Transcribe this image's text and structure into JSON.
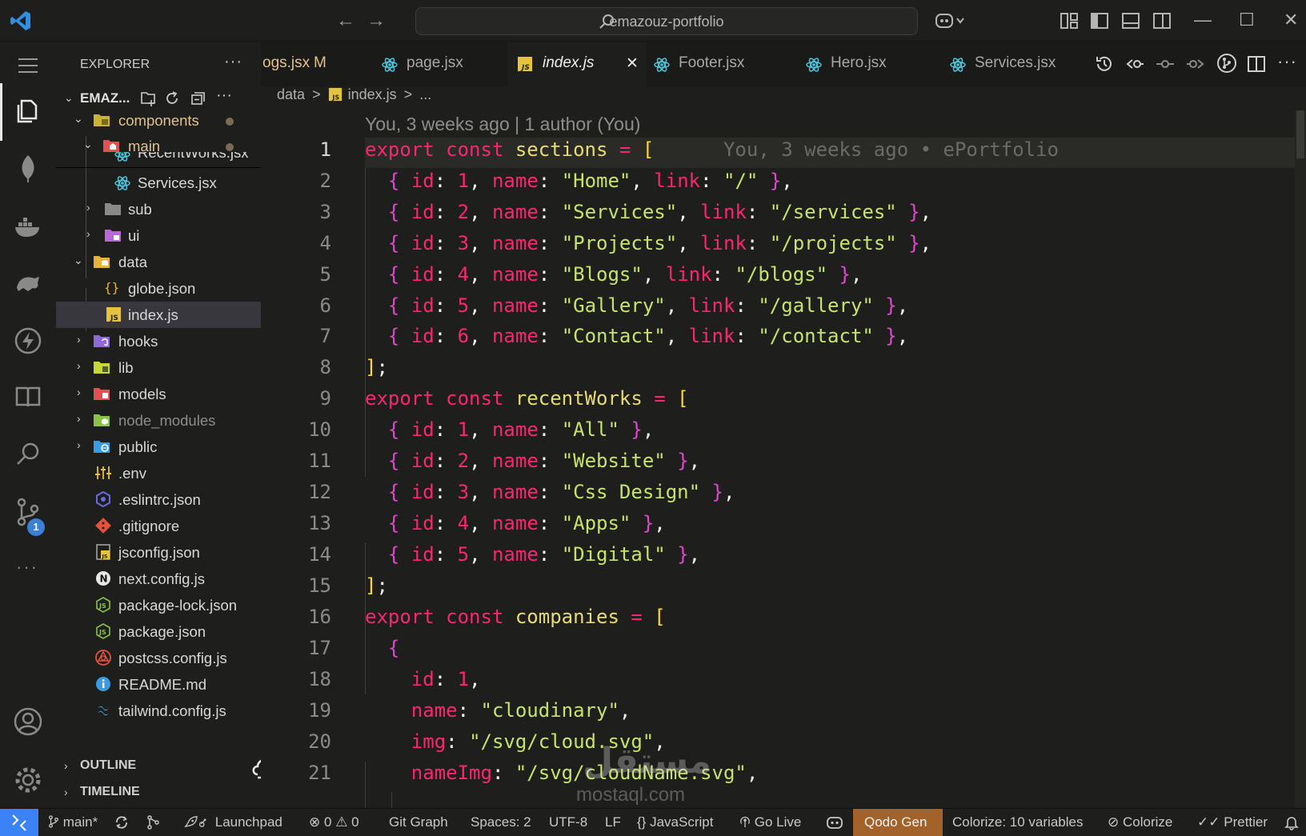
{
  "titlebar": {
    "search_text": "emazouz-portfolio",
    "back_symbol": "←",
    "forward_symbol": "→",
    "min_symbol": "—",
    "max_symbol": "☐",
    "close_symbol": "✕"
  },
  "activity": {
    "badge_count": "1",
    "more_symbol": "···"
  },
  "sidebar": {
    "header": "EXPLORER",
    "more": "···",
    "root": "EMAZ...",
    "outline": "OUTLINE",
    "timeline": "TIMELINE",
    "items": [
      {
        "label": "components"
      },
      {
        "label": "main"
      },
      {
        "label": "RecentWorks.jsx"
      },
      {
        "label": "Services.jsx"
      },
      {
        "label": "sub"
      },
      {
        "label": "ui"
      },
      {
        "label": "data"
      },
      {
        "label": "globe.json"
      },
      {
        "label": "index.js"
      },
      {
        "label": "hooks"
      },
      {
        "label": "lib"
      },
      {
        "label": "models"
      },
      {
        "label": "node_modules"
      },
      {
        "label": "public"
      },
      {
        "label": ".env"
      },
      {
        "label": ".eslintrc.json"
      },
      {
        "label": ".gitignore"
      },
      {
        "label": "jsconfig.json"
      },
      {
        "label": "next.config.js"
      },
      {
        "label": "package-lock.json"
      },
      {
        "label": "package.json"
      },
      {
        "label": "postcss.config.js"
      },
      {
        "label": "README.md"
      },
      {
        "label": "tailwind.config.js"
      }
    ]
  },
  "tabs": [
    {
      "label": "ogs.jsx",
      "status": "M"
    },
    {
      "label": "page.jsx"
    },
    {
      "label": "index.js",
      "close": "✕"
    },
    {
      "label": "Footer.jsx"
    },
    {
      "label": "Hero.jsx"
    },
    {
      "label": "Services.jsx"
    }
  ],
  "breadcrumbs": {
    "folder": "data",
    "file": "index.js",
    "sep": ">",
    "tail": "..."
  },
  "editor": {
    "blame_header": "You, 3 weeks ago | 1 author (You)",
    "inline_blame": "You, 3 weeks ago • ePortfolio",
    "line_numbers": [
      "1",
      "2",
      "3",
      "4",
      "5",
      "6",
      "7",
      "8",
      "9",
      "10",
      "11",
      "12",
      "13",
      "14",
      "15",
      "16",
      "17",
      "18",
      "19",
      "20",
      "21"
    ],
    "current_line": 1
  },
  "code": {
    "export": "export",
    "const": "const",
    "sections": "sections",
    "recentWorks": "recentWorks",
    "companies": "companies",
    "sections_items": [
      {
        "id": "1",
        "name": "\"Home\"",
        "link": "\"/\""
      },
      {
        "id": "2",
        "name": "\"Services\"",
        "link": "\"/services\""
      },
      {
        "id": "3",
        "name": "\"Projects\"",
        "link": "\"/projects\""
      },
      {
        "id": "4",
        "name": "\"Blogs\"",
        "link": "\"/blogs\""
      },
      {
        "id": "5",
        "name": "\"Gallery\"",
        "link": "\"/gallery\""
      },
      {
        "id": "6",
        "name": "\"Contact\"",
        "link": "\"/contact\""
      }
    ],
    "recent_items": [
      {
        "id": "1",
        "name": "\"All\""
      },
      {
        "id": "2",
        "name": "\"Website\""
      },
      {
        "id": "3",
        "name": "\"Css Design\""
      },
      {
        "id": "4",
        "name": "\"Apps\""
      },
      {
        "id": "5",
        "name": "\"Digital\""
      }
    ],
    "company": {
      "id": "1",
      "name": "\"cloudinary\"",
      "img": "\"/svg/cloud.svg\"",
      "nameImg": "\"/svg/cloudName.svg\""
    }
  },
  "status": {
    "branch": "main*",
    "errors": "0",
    "warnings": "0",
    "launchpad": "Launchpad",
    "git_graph": "Git Graph",
    "spaces": "Spaces: 2",
    "encoding": "UTF-8",
    "eol": "LF",
    "language_braces": "{}",
    "language": "JavaScript",
    "go_live": "Go Live",
    "qodo": "Qodo Gen",
    "colorize_vars": "Colorize: 10 variables",
    "colorize": "Colorize",
    "prettier": "Prettier"
  },
  "watermark": {
    "arabic": "مستقل",
    "latin": "mostaql.com"
  },
  "colors": {
    "accent": "#3b82f6",
    "keyword": "#f92672",
    "string": "#c6e36b",
    "qodo": "#a3622a"
  }
}
